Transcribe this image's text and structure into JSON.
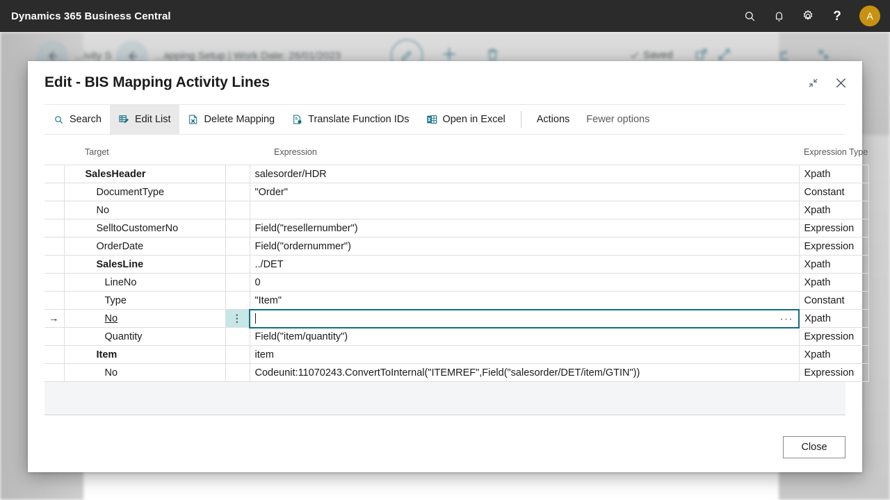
{
  "topbar": {
    "app_title": "Dynamics 365 Business Central",
    "avatar_initial": "A",
    "icons": [
      "search-icon",
      "notification-bell-icon",
      "settings-gear-icon",
      "help-question-icon"
    ]
  },
  "background": {
    "breadcrumb_1": "...ivity S",
    "breadcrumb_2": "...apping Setup | Work Date: 26/01/2023",
    "saved_status": "Saved",
    "tool_icons": [
      "edit-pencil-icon",
      "new-plus-icon",
      "delete-trash-icon",
      "open-in-new-window-icon",
      "expand-icon",
      "share-icon",
      "collapse-icon"
    ]
  },
  "dialog": {
    "title": "Edit - BIS Mapping Activity Lines",
    "minimize_icon": "restore-down-icon",
    "close_icon": "close-icon",
    "close_button_label": "Close"
  },
  "ribbon": {
    "items": [
      {
        "label": "Search",
        "icon": "search-icon",
        "active": false,
        "style": "plain"
      },
      {
        "label": "Edit List",
        "icon": "edit-list-icon",
        "active": true,
        "style": "plain"
      },
      {
        "label": "Delete Mapping",
        "icon": "delete-mapping-icon",
        "active": false,
        "style": "plain"
      },
      {
        "label": "Translate Function IDs",
        "icon": "translate-icon",
        "active": false,
        "style": "plain"
      },
      {
        "label": "Open in Excel",
        "icon": "excel-icon",
        "active": false,
        "style": "plain"
      }
    ],
    "actions_label": "Actions",
    "fewer_options_label": "Fewer options"
  },
  "grid": {
    "columns": [
      {
        "key": "target",
        "label": "Target"
      },
      {
        "key": "expression",
        "label": "Expression"
      },
      {
        "key": "expression_type",
        "label": "Expression Type"
      }
    ],
    "rows": [
      {
        "target": "SalesHeader",
        "level": 1,
        "bold": true,
        "expression": "salesorder/HDR",
        "expression_type": "Xpath",
        "selected": false
      },
      {
        "target": "DocumentType",
        "level": 2,
        "bold": false,
        "expression": "\"Order\"",
        "expression_type": "Constant",
        "selected": false
      },
      {
        "target": "No",
        "level": 2,
        "bold": false,
        "expression": "",
        "expression_type": "Xpath",
        "selected": false
      },
      {
        "target": "SelltoCustomerNo",
        "level": 2,
        "bold": false,
        "expression": "Field(\"resellernumber\")",
        "expression_type": "Expression",
        "selected": false
      },
      {
        "target": "OrderDate",
        "level": 2,
        "bold": false,
        "expression": "Field(\"ordernummer\")",
        "expression_type": "Expression",
        "selected": false
      },
      {
        "target": "SalesLine",
        "level": 2,
        "bold": true,
        "expression": "../DET",
        "expression_type": "Xpath",
        "selected": false
      },
      {
        "target": "LineNo",
        "level": 3,
        "bold": false,
        "expression": "0",
        "expression_type": "Xpath",
        "selected": false
      },
      {
        "target": "Type",
        "level": 3,
        "bold": false,
        "expression": "\"Item\"",
        "expression_type": "Constant",
        "selected": false
      },
      {
        "target": "No",
        "level": 3,
        "bold": false,
        "expression": "",
        "expression_type": "Xpath",
        "selected": true
      },
      {
        "target": "Quantity",
        "level": 3,
        "bold": false,
        "expression": "Field(\"item/quantity\")",
        "expression_type": "Expression",
        "selected": false
      },
      {
        "target": "Item",
        "level": 2,
        "bold": true,
        "expression": "item",
        "expression_type": "Xpath",
        "selected": false
      },
      {
        "target": "No",
        "level": 3,
        "bold": false,
        "expression": "Codeunit:11070243.ConvertToInternal(\"ITEMREF\",Field(\"salesorder/DET/item/GTIN\"))",
        "expression_type": "Expression",
        "selected": false
      }
    ],
    "selected_row_index": 8,
    "selected_cell": "expression",
    "selected_cell_value": "",
    "row_menu_glyph": "⋮",
    "assist_edit_glyph": "···",
    "row_indicator_glyph": "→"
  },
  "colors": {
    "header_bg": "#2b2b2b",
    "accent_teal": "#0f6e84",
    "selection_teal": "#c7e6e6",
    "avatar_gold": "#c89211"
  }
}
